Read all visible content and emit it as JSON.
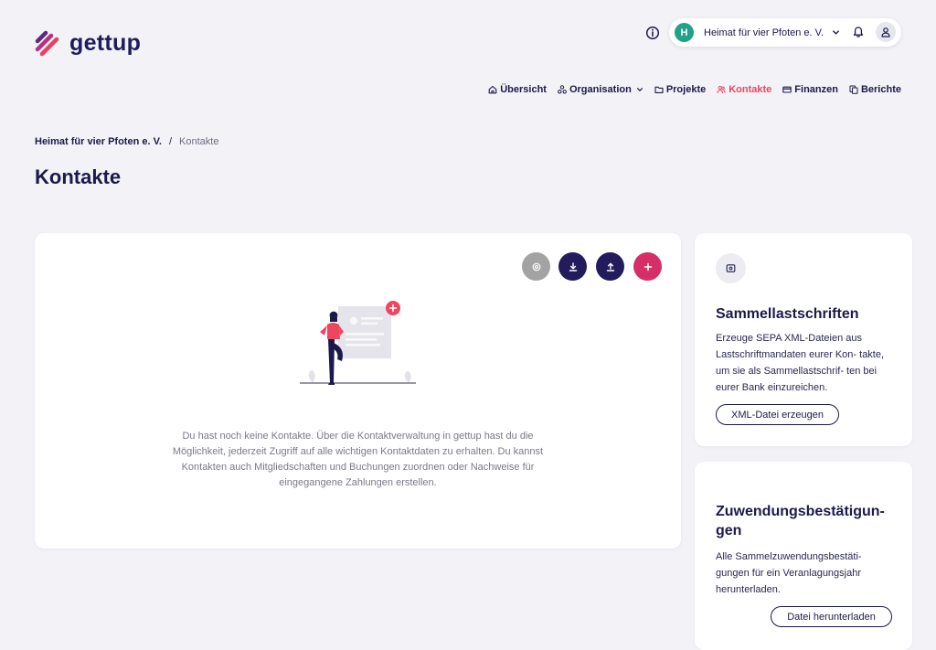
{
  "app": {
    "logo_text": "gettup"
  },
  "account": {
    "avatar_letter": "H",
    "org_name": "Heimat für vier Pfoten e. V."
  },
  "nav": [
    {
      "label": "Übersicht",
      "icon": "home-icon",
      "active": false
    },
    {
      "label": "Organisation",
      "icon": "organisation-icon",
      "active": false,
      "dropdown": true
    },
    {
      "label": "Projekte",
      "icon": "folder-icon",
      "active": false
    },
    {
      "label": "Kontakte",
      "icon": "contacts-icon",
      "active": true
    },
    {
      "label": "Finanzen",
      "icon": "card-icon",
      "active": false
    },
    {
      "label": "Berichte",
      "icon": "report-icon",
      "active": false
    }
  ],
  "breadcrumb": {
    "parent": "Heimat für vier Pfoten e. V.",
    "separator": "/",
    "current": "Kontakte"
  },
  "page": {
    "title": "Kontakte"
  },
  "empty_state": {
    "text": "Du hast noch keine Kontakte. Über die Kontaktverwaltung in gettup hast du die Möglichkeit, jederzeit Zugriff auf alle wichtigen Kontaktdaten zu erhalten. Du kannst Kontakten auch Mitgliedschaften und Buchungen zuordnen oder Nachweise für eingegangene Zahlungen erstellen."
  },
  "actions": {
    "settings_icon": "settings-icon",
    "download_icon": "download-icon",
    "upload_icon": "upload-icon",
    "add_icon": "plus-icon"
  },
  "sammellastschriften": {
    "title": "Sammellastschriften",
    "description": "Erzeuge SEPA XML-Dateien aus Lastschriftmandaten eurer Kon- takte, um sie als Sammellastschrif- ten bei eurer Bank einzureichen.",
    "button": "XML-Datei erzeugen"
  },
  "zuwendung": {
    "title": "Zuwendungsbestätigun- gen",
    "description": "Alle Sammelzuwendungsbestäti- gungen für ein Veranlagungsjahr herunterladen.",
    "button": "Datei herunterladen"
  },
  "colors": {
    "primary": "#1c1a4a",
    "accent": "#f0455e",
    "add_button": "#d62f67",
    "avatar": "#23a187",
    "background": "#f2f2f7"
  }
}
